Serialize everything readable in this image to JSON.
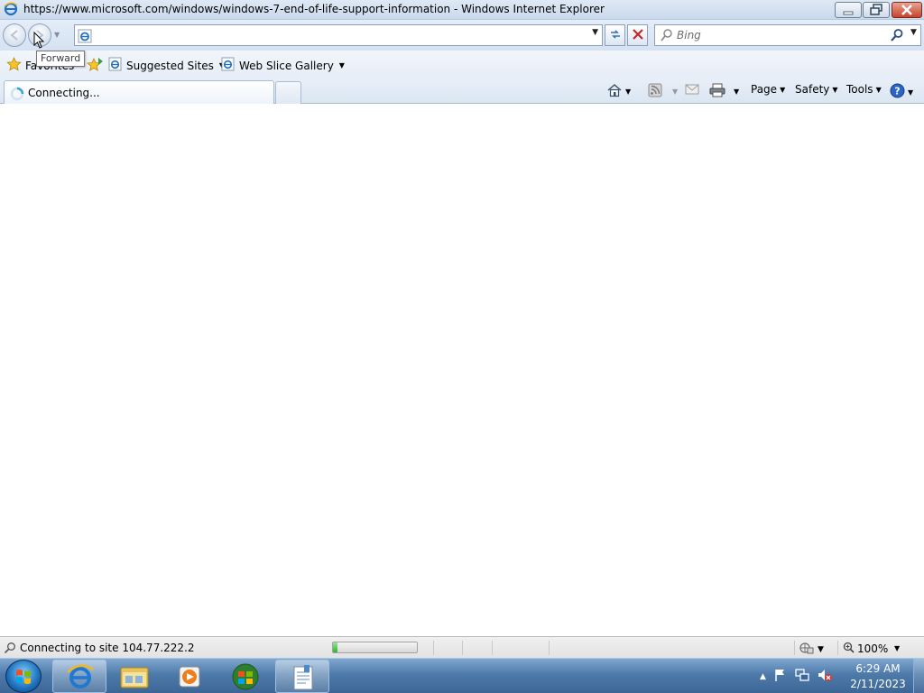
{
  "window": {
    "title": "https://www.microsoft.com/windows/windows-7-end-of-life-support-information - Windows Internet Explorer",
    "app_icon": "ie-icon"
  },
  "nav": {
    "address_value": "",
    "search_placeholder": "Bing",
    "tooltip": "Forward"
  },
  "favorites_bar": {
    "favorites_label": "Favorites",
    "items": [
      {
        "label": "Suggested Sites",
        "icon": "ie-page-icon"
      },
      {
        "label": "Web Slice Gallery",
        "icon": "ie-page-icon"
      }
    ]
  },
  "tab": {
    "title": "Connecting..."
  },
  "command_bar": {
    "page_label": "Page",
    "safety_label": "Safety",
    "tools_label": "Tools"
  },
  "status": {
    "text": "Connecting to site 104.77.222.2",
    "progress": 0.05,
    "zoom": "100%"
  },
  "taskbar": {
    "apps": [
      "internet-explorer",
      "windows-explorer",
      "media-player",
      "windows-logo",
      "document-app"
    ],
    "time": "6:29 AM",
    "date": "2/11/2023"
  }
}
